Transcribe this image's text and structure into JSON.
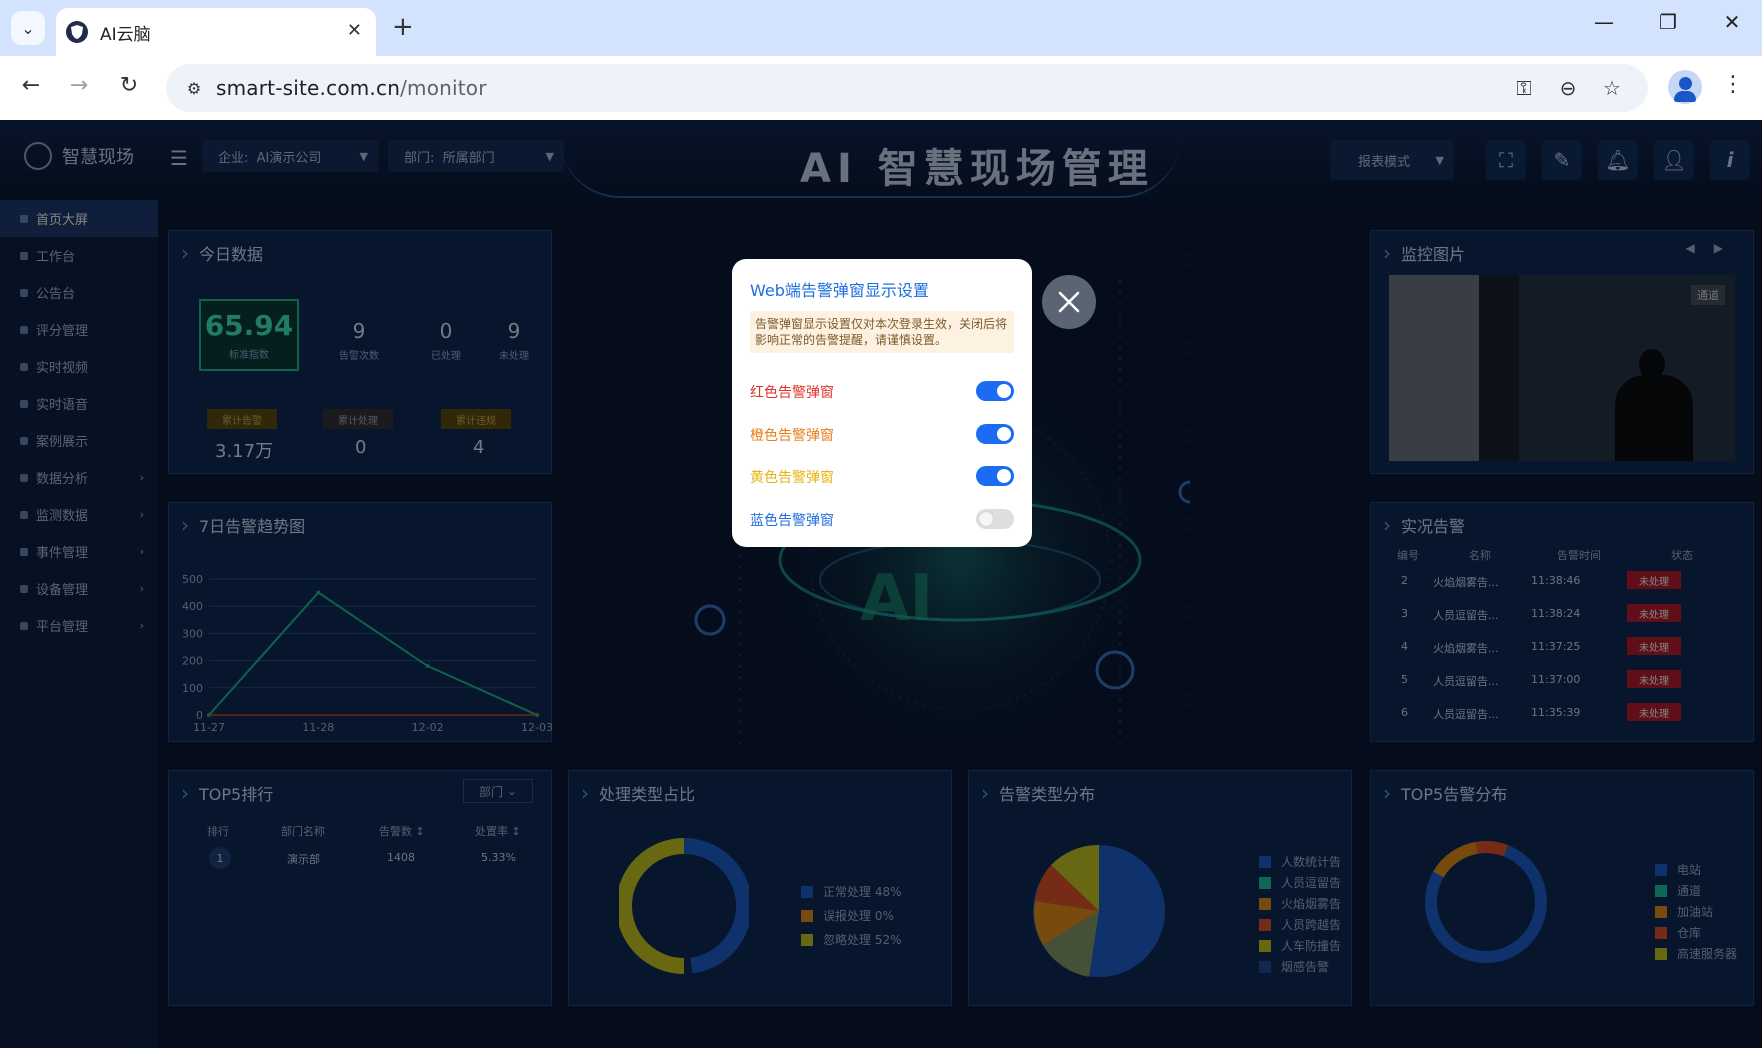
{
  "browser": {
    "tab_title": "AI云脑",
    "tab_close": "✕",
    "new_tab": "+",
    "url_domain": "smart-site.com.cn",
    "url_path": "/monitor",
    "win_minimize": "—",
    "win_restore": "❐",
    "win_close": "✕",
    "back": "←",
    "forward": "→",
    "reload": "↻",
    "key_icon": "⚿",
    "zoom_icon": "⊖",
    "star_icon": "☆",
    "menu": "⋮",
    "tab_menu": "⌄"
  },
  "app": {
    "logo_text": "智慧现场",
    "company_label": "企业:",
    "company_value": "AI演示公司",
    "dept_label": "部门:",
    "dept_value": "所属部门",
    "title": "AI 智慧现场管理",
    "mode": "报表模式",
    "header_icons": [
      "fullscreen-icon",
      "edit-icon",
      "bell-icon",
      "user-icon",
      "info-icon"
    ]
  },
  "sidebar": {
    "items": [
      {
        "label": "首页大屏",
        "active": true
      },
      {
        "label": "工作台"
      },
      {
        "label": "公告台"
      },
      {
        "label": "评分管理"
      },
      {
        "label": "实时视频"
      },
      {
        "label": "实时语音"
      },
      {
        "label": "案例展示"
      },
      {
        "label": "数据分析",
        "arrow": "›"
      },
      {
        "label": "监测数据",
        "arrow": "›"
      },
      {
        "label": "事件管理",
        "arrow": "›"
      },
      {
        "label": "设备管理",
        "arrow": "›"
      },
      {
        "label": "平台管理",
        "arrow": "›"
      }
    ]
  },
  "today": {
    "title": "今日数据",
    "score": "65.94",
    "score_label": "标准指数",
    "alarm_count": "9",
    "alarm_label": "告警次数",
    "processed": "0",
    "processed_label": "已处理",
    "unprocessed": "9",
    "unprocessed_label": "未处理",
    "tag1": "累计告警",
    "tag2": "累计处理",
    "tag3": "累计违规",
    "big1": "3.17万",
    "big2": "0",
    "big3": "4"
  },
  "trend": {
    "title": "7日告警趋势图",
    "y_ticks": [
      "500",
      "400",
      "300",
      "200",
      "100",
      "0"
    ],
    "x_ticks": [
      "11-27",
      "11-28",
      "12-02",
      "12-03"
    ]
  },
  "chart_data": {
    "type": "line",
    "title": "7日告警趋势图",
    "categories": [
      "11-27",
      "11-28",
      "12-02",
      "12-03"
    ],
    "series": [
      {
        "values": [
          0,
          450,
          180,
          0
        ]
      }
    ],
    "ylim": [
      0,
      500
    ]
  },
  "top5": {
    "title": "TOP5排行",
    "filter": "部门",
    "headers": [
      "排行",
      "部门名称",
      "告警数 ↕",
      "处置率 ↕"
    ],
    "rows": [
      {
        "rank": "1",
        "name": "演示部",
        "count": "1408",
        "rate": "5.33%"
      }
    ]
  },
  "process_type": {
    "title": "处理类型占比",
    "legend": [
      {
        "label": "正常处理 48%",
        "color": "#1e5fd0"
      },
      {
        "label": "误报处理 0%",
        "color": "#e48f19"
      },
      {
        "label": "忽略处理 52%",
        "color": "#c8c524"
      }
    ]
  },
  "alarm_type": {
    "title": "告警类型分布",
    "legend": [
      {
        "label": "人数统计告",
        "color": "#1e5fd0"
      },
      {
        "label": "人员逗留告",
        "color": "#1ec6a8"
      },
      {
        "label": "火焰烟雾告",
        "color": "#e48f19"
      },
      {
        "label": "人员跨越告",
        "color": "#e0542a"
      },
      {
        "label": "人车防撞告",
        "color": "#c8c524"
      },
      {
        "label": "烟感告警",
        "color": "#2347a0"
      }
    ]
  },
  "top5_dist": {
    "title": "TOP5告警分布",
    "legend": [
      {
        "label": "电站",
        "color": "#1e5fd0"
      },
      {
        "label": "通道",
        "color": "#1ec6a8"
      },
      {
        "label": "加油站",
        "color": "#e48f19"
      },
      {
        "label": "仓库",
        "color": "#e0542a"
      },
      {
        "label": "高速服务器",
        "color": "#c8c524"
      }
    ]
  },
  "monitor": {
    "title": "监控图片",
    "channel": "通道"
  },
  "live_alarms": {
    "title": "实况告警",
    "headers": [
      "编号",
      "名称",
      "告警时间",
      "状态"
    ],
    "rows": [
      {
        "id": "2",
        "name": "火焰烟雾告...",
        "time": "11:38:46",
        "status": "未处理"
      },
      {
        "id": "3",
        "name": "人员逗留告...",
        "time": "11:38:24",
        "status": "未处理"
      },
      {
        "id": "4",
        "name": "火焰烟雾告...",
        "time": "11:37:25",
        "status": "未处理"
      },
      {
        "id": "5",
        "name": "人员逗留告...",
        "time": "11:37:00",
        "status": "未处理"
      },
      {
        "id": "6",
        "name": "人员逗留告...",
        "time": "11:35:39",
        "status": "未处理"
      }
    ]
  },
  "modal": {
    "title": "Web端告警弹窗显示设置",
    "warning": "告警弹窗显示设置仅对本次登录生效，关闭后将影响正常的告警提醒，请谨慎设置。",
    "options": [
      {
        "label": "红色告警弹窗",
        "color": "#e0332b",
        "on": true
      },
      {
        "label": "橙色告警弹窗",
        "color": "#e97d18",
        "on": true
      },
      {
        "label": "黄色告警弹窗",
        "color": "#e6b40c",
        "on": true
      },
      {
        "label": "蓝色告警弹窗",
        "color": "#1f6fe0",
        "on": false
      }
    ]
  }
}
